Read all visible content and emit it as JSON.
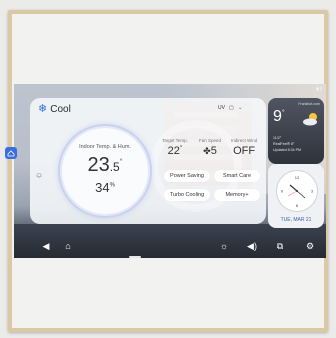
{
  "status": {
    "battery_glyph": "▮ ▯"
  },
  "mode": {
    "icon": "snowflake-icon",
    "label": "Cool"
  },
  "chips": {
    "uv_label": "UV",
    "indicator_glyph": "▢",
    "dropdown_glyph": "⌄"
  },
  "indoor": {
    "title": "Indoor Temp. & Hum.",
    "temp_int": "23",
    "temp_dec": ".5",
    "temp_unit": "°",
    "humidity": "34",
    "humidity_unit": "%"
  },
  "controls": [
    {
      "caption": "Target Temp.",
      "value": "22",
      "unit": "°"
    },
    {
      "caption": "Fan Speed",
      "value": "5",
      "icon": "fan-icon"
    },
    {
      "caption": "Indirect Wind",
      "value": "OFF"
    }
  ],
  "pills": [
    "Power Saving",
    "Smart Care",
    "Turbo Cooling",
    "Memory+"
  ],
  "weather": {
    "city": "Frankfurt.com",
    "temp": "9",
    "temp_unit": "°",
    "line1": "11/2°",
    "line2": "RealFeel® 8°",
    "line3": "Updated 8:34 PM",
    "icon": "partly-cloudy-icon"
  },
  "clock": {
    "date": "TUE, MAR 21",
    "marks": [
      "12",
      "3",
      "6",
      "9"
    ]
  },
  "navbar": {
    "back_icon": "back-icon",
    "home_icon": "home-icon",
    "brightness_icon": "brightness-icon",
    "volume_icon": "volume-icon",
    "cast_icon": "cast-icon",
    "settings_icon": "settings-icon"
  },
  "colors": {
    "accent": "#2f6ddf",
    "frame": "#dcc8a4"
  }
}
